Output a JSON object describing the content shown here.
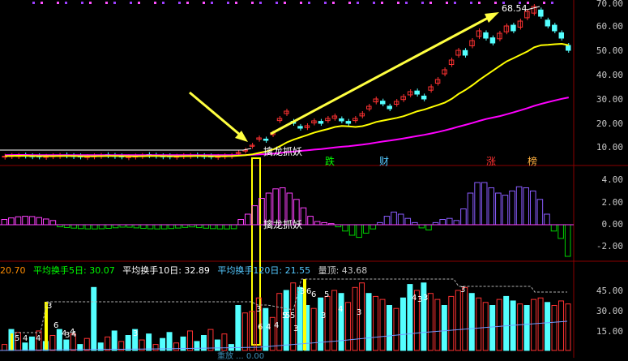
{
  "colors": {
    "up": "#ff3232",
    "down": "#54ffff",
    "ma_short": "#ffff00",
    "ma_long": "#ff00ff",
    "macd_up": "#8a5cff",
    "macd_down": "#00d000",
    "volume_avg": "#6f9bff",
    "annotation_arrow": "#ffff40",
    "highlight_box": "#ffff00"
  },
  "price_panel": {
    "y_ticks": [
      "70.00",
      "60.00",
      "50.00",
      "40.00",
      "30.00",
      "20.00",
      "10.00"
    ],
    "peak_label": "68.54",
    "signal_label": "擒龙抓妖",
    "tags": [
      {
        "text": "跌",
        "color": "#00ff00"
      },
      {
        "text": "财",
        "color": "#54c8ff"
      },
      {
        "text": "涨",
        "color": "#ff3232"
      },
      {
        "text": "榜",
        "color": "#ffb040"
      }
    ]
  },
  "indicator_panel": {
    "y_ticks": [
      "4.00",
      "2.00",
      "0.00",
      "-2.00"
    ],
    "signal_label": "擒龙抓妖"
  },
  "volume_panel": {
    "status": {
      "first_value": "20.70",
      "ma5": "平均换手5日: 30.07",
      "ma10": "平均换手10日: 32.89",
      "ma120": "平均换手120日: 21.55",
      "peak": "量顶: 43.68"
    },
    "y_ticks": [
      "45.00",
      "30.00",
      "15.00"
    ],
    "bottom_partial": "重放  ... 0.00",
    "bar_labels": [
      "5",
      "4",
      "4",
      "3",
      "6",
      "4",
      "3",
      "4",
      "4",
      "3",
      "3",
      "6",
      "4",
      "4",
      "5",
      "5",
      "5",
      "3",
      "3",
      "6",
      "6",
      "5",
      "3",
      "4",
      "4",
      "3",
      "3",
      "3",
      "3"
    ]
  }
}
